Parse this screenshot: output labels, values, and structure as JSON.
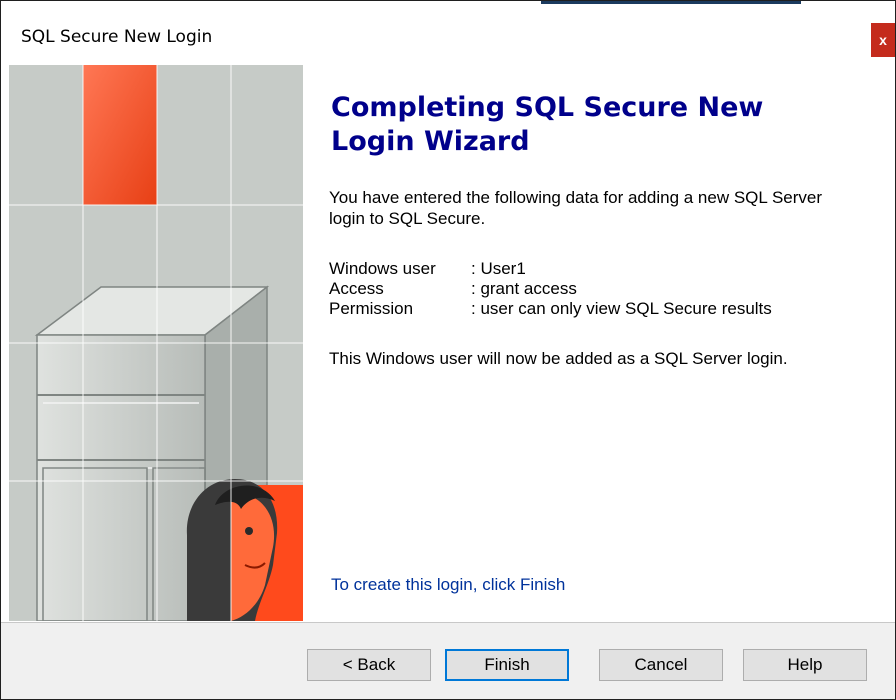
{
  "window": {
    "title": "SQL Secure New Login",
    "close_glyph": "x"
  },
  "content": {
    "heading": "Completing SQL Secure New Login Wizard",
    "intro": "You have entered the following data for adding a new SQL Server login to SQL Secure.",
    "summary": [
      {
        "label": "Windows user",
        "value": ": User1"
      },
      {
        "label": "Access",
        "value": ": grant access"
      },
      {
        "label": "Permission",
        "value": ": user can only view SQL Secure results"
      }
    ],
    "note": "This Windows user will now be added as a SQL Server login.",
    "finish_hint": "To create this login, click Finish"
  },
  "buttons": {
    "back": "< Back",
    "finish": "Finish",
    "cancel": "Cancel",
    "help": "Help"
  },
  "colors": {
    "heading": "#00008b",
    "link": "#00329b",
    "accent_orange": "#ff4a1c",
    "close_red": "#c42b1c"
  },
  "icons": {
    "close": "close-icon",
    "wizard_art": "wizard-illustration"
  }
}
